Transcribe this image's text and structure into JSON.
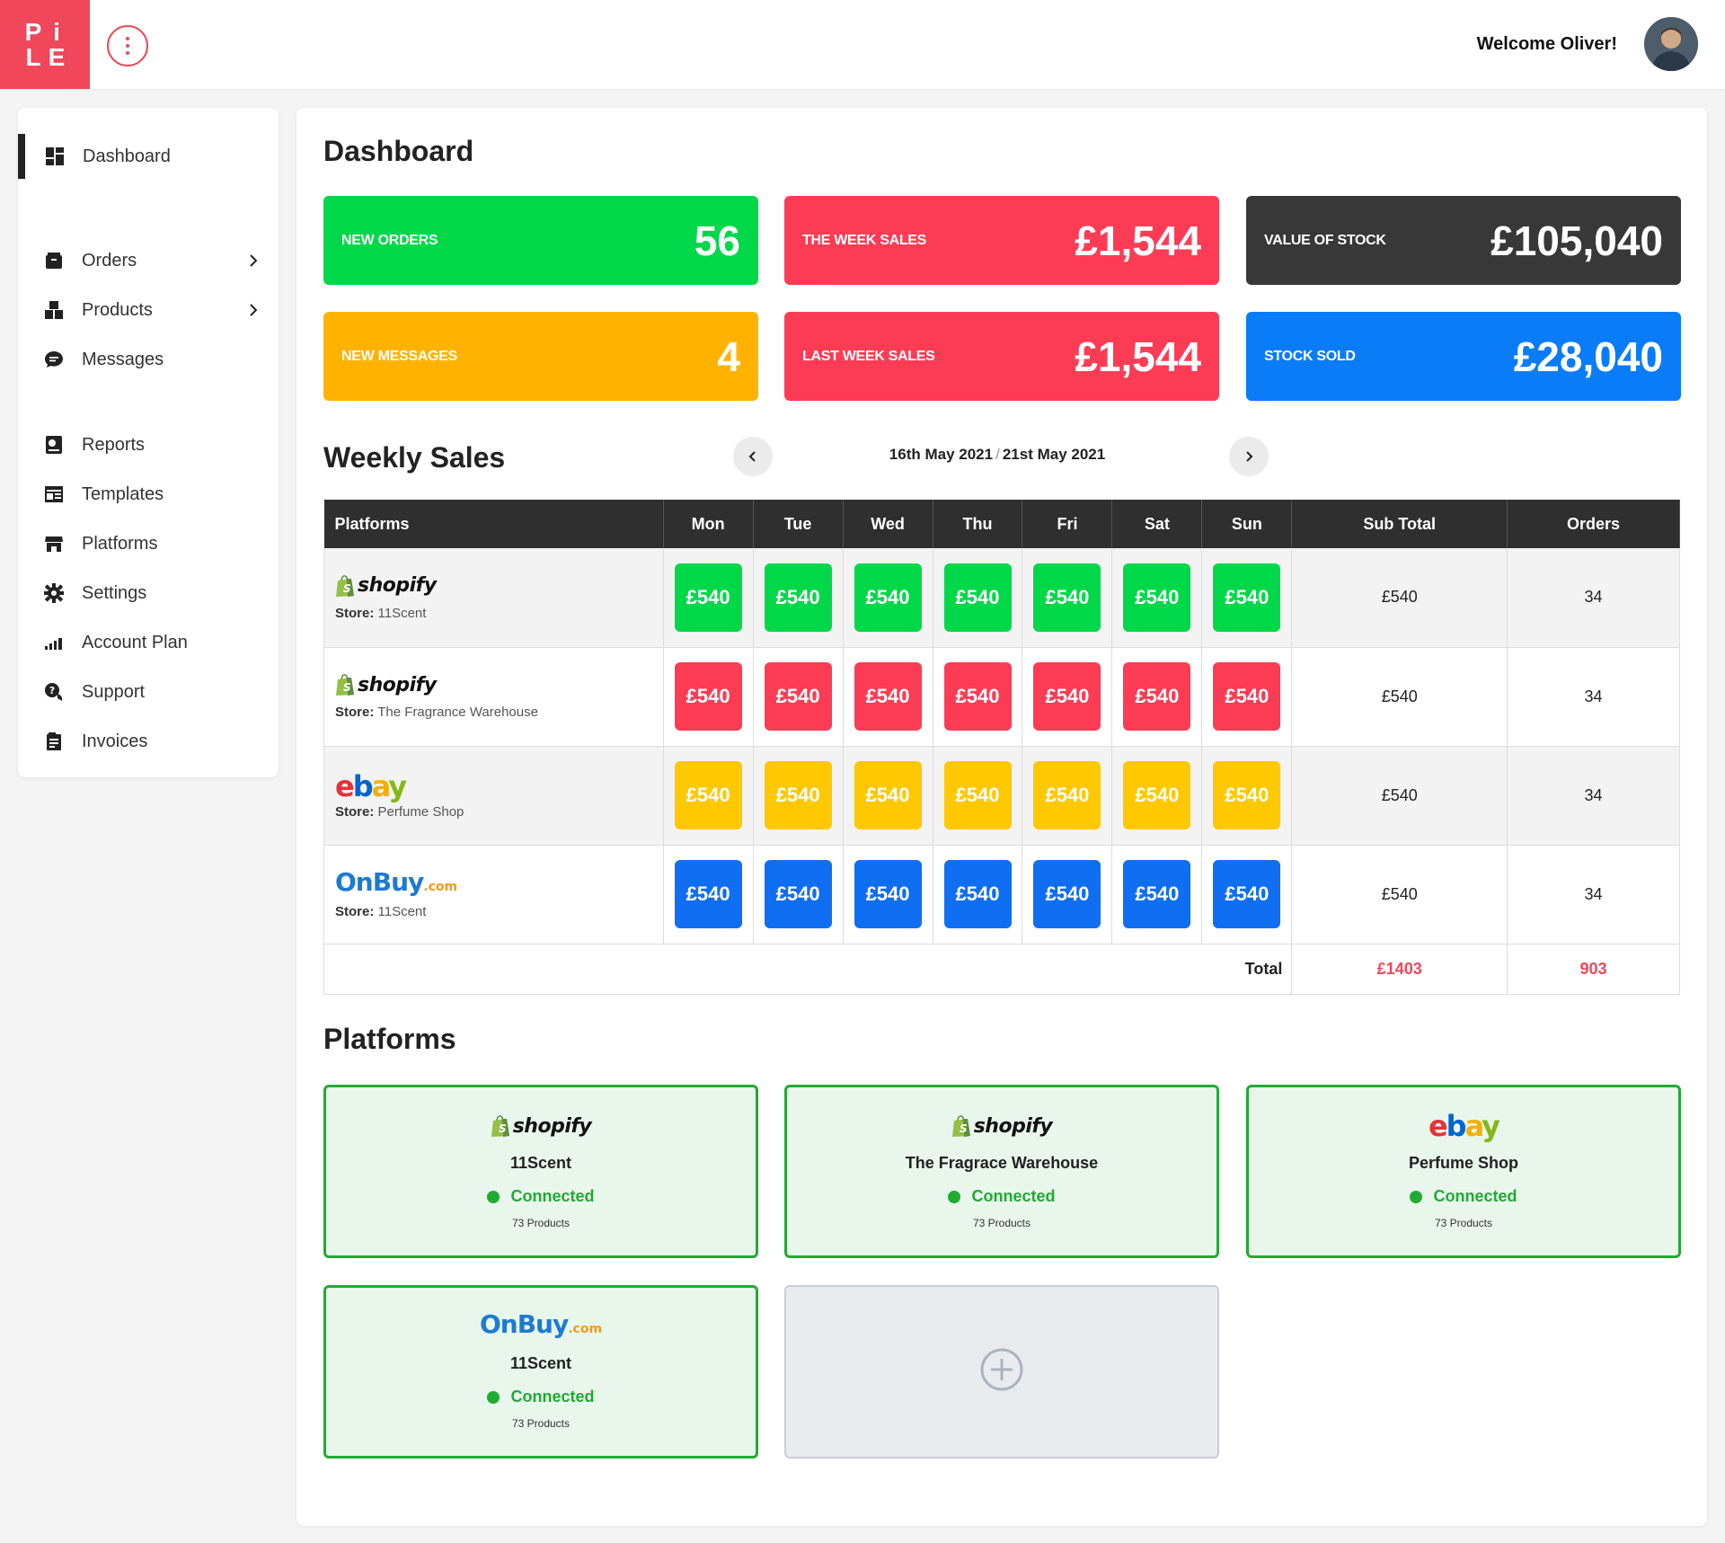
{
  "header": {
    "logo_letters": [
      "P",
      "i",
      "L",
      "E"
    ],
    "welcome": "Welcome Oliver!"
  },
  "sidebar": {
    "items": [
      {
        "label": "Dashboard",
        "icon": "dashboard-icon"
      },
      {
        "label": "Orders",
        "icon": "box-icon",
        "chevron": true
      },
      {
        "label": "Products",
        "icon": "boxes-icon",
        "chevron": true
      },
      {
        "label": "Messages",
        "icon": "chat-icon"
      },
      {
        "label": "Reports",
        "icon": "report-icon"
      },
      {
        "label": "Templates",
        "icon": "template-icon"
      },
      {
        "label": "Platforms",
        "icon": "store-icon"
      },
      {
        "label": "Settings",
        "icon": "gear-icon"
      },
      {
        "label": "Account Plan",
        "icon": "signal-icon"
      },
      {
        "label": "Support",
        "icon": "support-icon"
      },
      {
        "label": "Invoices",
        "icon": "invoice-icon"
      }
    ]
  },
  "dashboard": {
    "title": "Dashboard",
    "stats": [
      {
        "label": "NEW ORDERS",
        "value": "56",
        "color": "#00d84a"
      },
      {
        "label": "THE WEEK SALES",
        "value": "£1,544",
        "color": "#fc3c55"
      },
      {
        "label": "VALUE OF STOCK",
        "value": "£105,040",
        "color": "#383838"
      },
      {
        "label": "NEW MESSAGES",
        "value": "4",
        "color": "#ffb300"
      },
      {
        "label": "LAST WEEK SALES",
        "value": "£1,544",
        "color": "#fc3c55"
      },
      {
        "label": "STOCK SOLD",
        "value": "£28,040",
        "color": "#0a7cf8"
      }
    ]
  },
  "weekly": {
    "title": "Weekly Sales",
    "date_start": "16th May 2021",
    "date_sep": "/",
    "date_end": "21st May 2021",
    "columns": [
      "Platforms",
      "Mon",
      "Tue",
      "Wed",
      "Thu",
      "Fri",
      "Sat",
      "Sun",
      "Sub Total",
      "Orders"
    ],
    "rows": [
      {
        "platform": "shopify",
        "store_label": "Store:",
        "store": "11Scent",
        "days": [
          "£540",
          "£540",
          "£540",
          "£540",
          "£540",
          "£540",
          "£540"
        ],
        "chip_color": "#00d84a",
        "subtotal": "£540",
        "orders": "34"
      },
      {
        "platform": "shopify",
        "store_label": "Store:",
        "store": "The Fragrance Warehouse",
        "days": [
          "£540",
          "£540",
          "£540",
          "£540",
          "£540",
          "£540",
          "£540"
        ],
        "chip_color": "#fc3c55",
        "subtotal": "£540",
        "orders": "34"
      },
      {
        "platform": "ebay",
        "store_label": "Store:",
        "store": "Perfume Shop",
        "days": [
          "£540",
          "£540",
          "£540",
          "£540",
          "£540",
          "£540",
          "£540"
        ],
        "chip_color": "#ffc800",
        "subtotal": "£540",
        "orders": "34"
      },
      {
        "platform": "onbuy",
        "store_label": "Store:",
        "store": "11Scent",
        "days": [
          "£540",
          "£540",
          "£540",
          "£540",
          "£540",
          "£540",
          "£540"
        ],
        "chip_color": "#0f6ef2",
        "subtotal": "£540",
        "orders": "34"
      }
    ],
    "total_label": "Total",
    "total_subtotal": "£1403",
    "total_orders": "903"
  },
  "platforms": {
    "title": "Platforms",
    "cards": [
      {
        "platform": "shopify",
        "name": "11Scent",
        "status": "Connected",
        "count": "73 Products"
      },
      {
        "platform": "shopify",
        "name": "The Fragrace Warehouse",
        "status": "Connected",
        "count": "73 Products"
      },
      {
        "platform": "ebay",
        "name": "Perfume Shop",
        "status": "Connected",
        "count": "73 Products"
      },
      {
        "platform": "onbuy",
        "name": "11Scent",
        "status": "Connected",
        "count": "73 Products"
      }
    ]
  },
  "brands": {
    "shopify": "shopify",
    "ebay": [
      "e",
      "b",
      "a",
      "y"
    ],
    "ebay_colors": [
      "#e53238",
      "#0064d2",
      "#f5af02",
      "#86b817"
    ],
    "onbuy": "OnBuy",
    "onbuy_com": ".com"
  }
}
